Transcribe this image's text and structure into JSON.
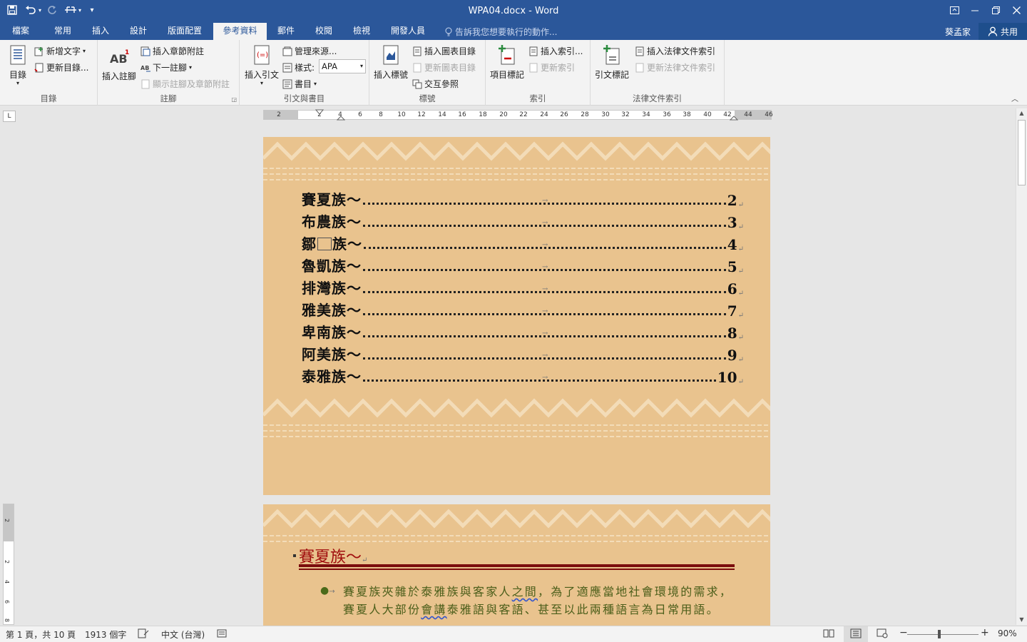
{
  "window": {
    "title": "WPA04.docx - Word",
    "controls": [
      "ribbon-display-options",
      "minimize",
      "restore",
      "close"
    ]
  },
  "qat": {
    "save_icon": "save-icon",
    "undo_icon": "undo-icon",
    "redo_icon": "redo-icon",
    "touch_mode_icon": "touch-mode-icon",
    "customize_icon": "customize-qat-icon"
  },
  "tabs": [
    {
      "label": "檔案"
    },
    {
      "label": "常用"
    },
    {
      "label": "插入"
    },
    {
      "label": "設計"
    },
    {
      "label": "版面配置"
    },
    {
      "label": "參考資料",
      "active": true
    },
    {
      "label": "郵件"
    },
    {
      "label": "校閱"
    },
    {
      "label": "檢視"
    },
    {
      "label": "開發人員"
    }
  ],
  "tellme": {
    "placeholder": "告訴我您想要執行的動作..."
  },
  "user": {
    "name": "葵孟家",
    "share_label": "共用"
  },
  "ribbon": {
    "toc_group": {
      "label": "目錄",
      "toc_button": "目錄",
      "add_text": "新增文字",
      "update_toc": "更新目錄..."
    },
    "footnotes_group": {
      "label": "註腳",
      "insert_footnote": "插入註腳",
      "insert_endnote": "插入章節附註",
      "next_footnote": "下一註腳",
      "show_notes": "顯示註腳及章節附註"
    },
    "citations_group": {
      "label": "引文與書目",
      "insert_citation": "插入引文",
      "manage_sources": "管理來源...",
      "style_label": "樣式:",
      "style_value": "APA",
      "bibliography": "書目"
    },
    "captions_group": {
      "label": "標號",
      "insert_caption": "插入標號",
      "insert_table_of_figures": "插入圖表目錄",
      "update_table": "更新圖表目錄",
      "cross_reference": "交互參照"
    },
    "index_group": {
      "label": "索引",
      "mark_entry": "項目標記",
      "insert_index": "插入索引...",
      "update_index": "更新索引"
    },
    "authorities_group": {
      "label": "法律文件索引",
      "mark_citation": "引文標記",
      "insert_toa": "插入法律文件索引",
      "update_toa": "更新法律文件索引"
    }
  },
  "ruler": {
    "ticks": [
      "2",
      "2",
      "4",
      "6",
      "8",
      "10",
      "12",
      "14",
      "16",
      "18",
      "20",
      "22",
      "24",
      "26",
      "28",
      "30",
      "32",
      "34",
      "36",
      "38",
      "40",
      "42",
      "44",
      "46"
    ],
    "corner": "L",
    "vertical_ticks": [
      "2",
      "2",
      "4",
      "6",
      "8"
    ]
  },
  "document": {
    "toc": [
      {
        "name": "賽夏族～",
        "page": "2"
      },
      {
        "name": "布農族～",
        "page": "3"
      },
      {
        "name_parts": [
          "鄒",
          "族～"
        ],
        "page": "4"
      },
      {
        "name": "魯凱族～",
        "page": "5"
      },
      {
        "name": "排灣族～",
        "page": "6"
      },
      {
        "name": "雅美族～",
        "page": "7"
      },
      {
        "name": "卑南族～",
        "page": "8"
      },
      {
        "name": "阿美族～",
        "page": "9"
      },
      {
        "name": "泰雅族～",
        "page": "10"
      }
    ],
    "para_mark": "↵",
    "tab_mark": "→",
    "heading": "賽夏族～",
    "body_parts": [
      "賽夏族夾雜於泰雅族與客家人",
      "之間",
      "，為了適應當地社會環境的需求，賽夏人大部份",
      "會講",
      "泰雅語與客語、甚至以此兩種語言為日常用語。"
    ]
  },
  "colors": {
    "title_bar": "#2b579a",
    "page_bg": "#e9c38e",
    "heading": "#a00e0e",
    "body": "#4b5e1a"
  },
  "status": {
    "page": "第 1 頁，共 10 頁",
    "words": "1913 個字",
    "language": "中文 (台灣)",
    "zoom": "90%"
  }
}
